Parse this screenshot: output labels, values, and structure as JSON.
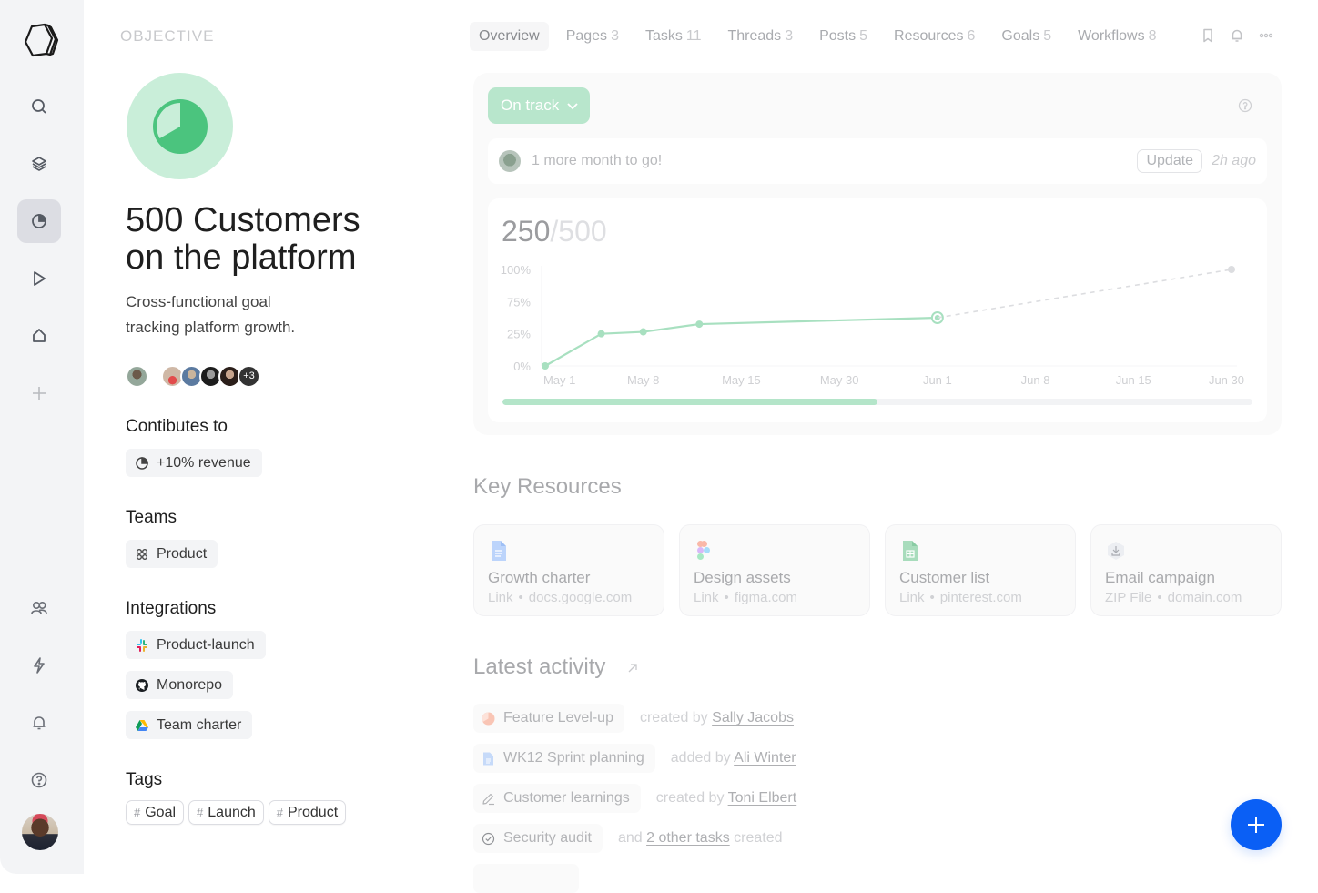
{
  "sidebar": {
    "items": [
      {
        "name": "search",
        "icon": "search-icon"
      },
      {
        "name": "layers",
        "icon": "layers-icon"
      },
      {
        "name": "goals",
        "icon": "pie-chart-icon",
        "active": true
      },
      {
        "name": "play",
        "icon": "play-icon"
      },
      {
        "name": "home",
        "icon": "home-icon"
      },
      {
        "name": "add",
        "icon": "plus-icon"
      },
      {
        "name": "people",
        "icon": "people-icon"
      },
      {
        "name": "automations",
        "icon": "lightning-icon"
      },
      {
        "name": "notifications",
        "icon": "bell-icon"
      },
      {
        "name": "help",
        "icon": "help-icon"
      }
    ]
  },
  "objective": {
    "eyebrow": "OBJECTIVE",
    "title_line1": "500 Customers",
    "title_line2": "on the platform",
    "desc_line1": "Cross-functional goal",
    "desc_line2": "tracking platform growth.",
    "extra_members": "+3",
    "contributes_heading": "Contibutes to",
    "contributes": "+10% revenue",
    "teams_heading": "Teams",
    "team": "Product",
    "integrations_heading": "Integrations",
    "integrations": [
      {
        "label": "Product-launch",
        "icon": "slack-icon"
      },
      {
        "label": "Monorepo",
        "icon": "github-icon"
      },
      {
        "label": "Team charter",
        "icon": "google-drive-icon"
      }
    ],
    "tags_heading": "Tags",
    "tags": [
      "Goal",
      "Launch",
      "Product"
    ]
  },
  "tabs": [
    {
      "label": "Overview",
      "count": ""
    },
    {
      "label": "Pages",
      "count": "3"
    },
    {
      "label": "Tasks",
      "count": "11"
    },
    {
      "label": "Threads",
      "count": "3"
    },
    {
      "label": "Posts",
      "count": "5"
    },
    {
      "label": "Resources",
      "count": "6"
    },
    {
      "label": "Goals",
      "count": "5"
    },
    {
      "label": "Workflows",
      "count": "8"
    }
  ],
  "status": {
    "label": "On track",
    "color": "#b8e6cc",
    "update_text": "1 more month to go!",
    "update_button": "Update",
    "update_time": "2h ago"
  },
  "progress": {
    "current": "250",
    "separator": "/",
    "target": "500",
    "fraction": 0.5
  },
  "chart_data": {
    "type": "line",
    "title": "250/500",
    "xlabel": "",
    "ylabel": "",
    "y_ticks": [
      "100%",
      "75%",
      "25%",
      "0%"
    ],
    "x_ticks": [
      "May 1",
      "May 8",
      "May 15",
      "May 30",
      "Jun 1",
      "Jun 8",
      "Jun 15",
      "Jun 30"
    ],
    "series": [
      {
        "name": "actual",
        "style": "solid",
        "color": "#a8e0c0",
        "points": [
          {
            "x": "May 1",
            "y": 0
          },
          {
            "x": "May 5",
            "y": 25
          },
          {
            "x": "May 8",
            "y": 28
          },
          {
            "x": "May 12",
            "y": 40
          },
          {
            "x": "Jun 1",
            "y": 50
          }
        ]
      },
      {
        "name": "projection",
        "style": "dashed",
        "color": "#dcdde0",
        "points": [
          {
            "x": "Jun 1",
            "y": 50
          },
          {
            "x": "Jun 30",
            "y": 100
          }
        ]
      }
    ],
    "ylim": [
      0,
      100
    ],
    "grid": false,
    "legend": "none"
  },
  "resources": {
    "heading": "Key Resources",
    "items": [
      {
        "name": "Growth charter",
        "type": "Link",
        "domain": "docs.google.com",
        "icon": "google-docs-icon"
      },
      {
        "name": "Design assets",
        "type": "Link",
        "domain": "figma.com",
        "icon": "figma-icon"
      },
      {
        "name": "Customer list",
        "type": "Link",
        "domain": "pinterest.com",
        "icon": "google-sheets-icon"
      },
      {
        "name": "Email campaign",
        "type": "ZIP File",
        "domain": "domain.com",
        "icon": "download-icon"
      }
    ]
  },
  "activity": {
    "heading": "Latest activity",
    "items": [
      {
        "title": "Feature Level-up",
        "icon": "goal-pie-icon",
        "verb": "created by",
        "user": "Sally Jacobs",
        "suffix": ""
      },
      {
        "title": "WK12 Sprint planning",
        "icon": "document-icon",
        "verb": "added by",
        "user": "Ali Winter",
        "suffix": ""
      },
      {
        "title": "Customer learnings",
        "icon": "pencil-icon",
        "verb": "created by",
        "user": "Toni Elbert",
        "suffix": ""
      },
      {
        "title": "Security audit",
        "icon": "check-circle-icon",
        "verb": "and",
        "user": "2 other tasks",
        "suffix": "created"
      }
    ]
  },
  "colors": {
    "accent_green": "#4bc47e",
    "fab_blue": "#0a5ff5"
  }
}
